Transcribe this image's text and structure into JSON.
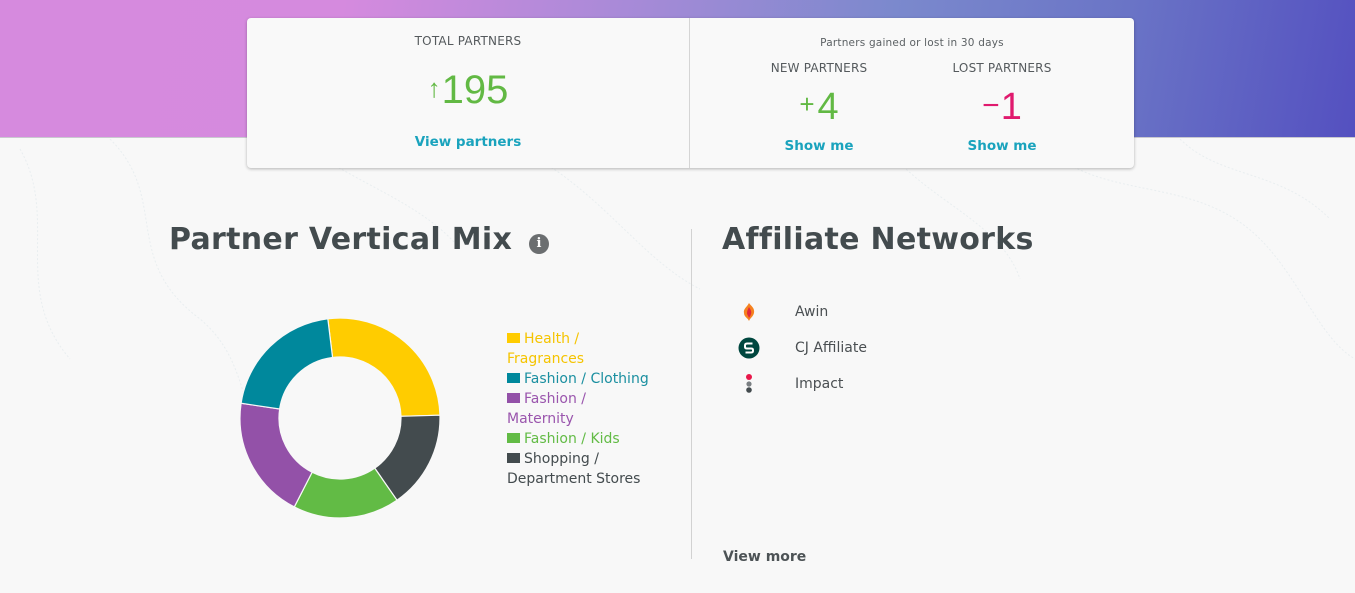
{
  "summary": {
    "total": {
      "label": "TOTAL PARTNERS",
      "arrow_icon": "arrow-up-icon",
      "arrow": "↑",
      "value": "195",
      "link": "View partners"
    },
    "change": {
      "caption": "Partners gained or lost in 30 days",
      "new": {
        "label": "NEW PARTNERS",
        "sign": "+",
        "value": "4",
        "link": "Show me"
      },
      "lost": {
        "label": "LOST PARTNERS",
        "sign": "−",
        "value": "1",
        "link": "Show me"
      }
    },
    "colors": {
      "positive": "#62b944",
      "negative": "#e01a6e",
      "link": "#1aa3bd"
    }
  },
  "vertical_mix": {
    "title": "Partner Vertical Mix",
    "info_icon": "info-icon",
    "info_glyph": "i"
  },
  "chart_data": {
    "type": "pie",
    "title": "Partner Vertical Mix",
    "donut": true,
    "legend_position": "right",
    "categories": [
      "Health / Fragrances",
      "Shopping / Department Stores",
      "Fashion / Kids",
      "Fashion / Maternity",
      "Fashion / Clothing"
    ],
    "values": [
      26.5,
      15.8,
      17.2,
      19.8,
      20.7
    ],
    "unit": "percent (estimated)",
    "start_angle_deg": -7,
    "colors": {
      "Health / Fragrances": "#ffcc00",
      "Fashion / Clothing": "#00889c",
      "Fashion / Maternity": "#9351a8",
      "Fashion / Kids": "#62bb45",
      "Shopping / Department Stores": "#434b4e"
    },
    "legend": [
      {
        "label": "Health / Fragrances",
        "color": "#ffcc00",
        "text_color": "#f5c400"
      },
      {
        "label": "Fashion / Clothing",
        "color": "#00889c",
        "text_color": "#1a8fa0"
      },
      {
        "label": "Fashion / Maternity",
        "color": "#9351a8",
        "text_color": "#9a55ad"
      },
      {
        "label": "Fashion / Kids",
        "color": "#62bb45",
        "text_color": "#62bb45"
      },
      {
        "label": "Shopping / Department Stores",
        "color": "#434b4e",
        "text_color": "#434b4e"
      }
    ]
  },
  "affiliate_networks": {
    "title": "Affiliate Networks",
    "items": [
      {
        "name": "Awin",
        "icon": "awin-logo-icon"
      },
      {
        "name": "CJ Affiliate",
        "icon": "cj-affiliate-logo-icon"
      },
      {
        "name": "Impact",
        "icon": "impact-logo-icon"
      }
    ],
    "view_more": "View more"
  }
}
